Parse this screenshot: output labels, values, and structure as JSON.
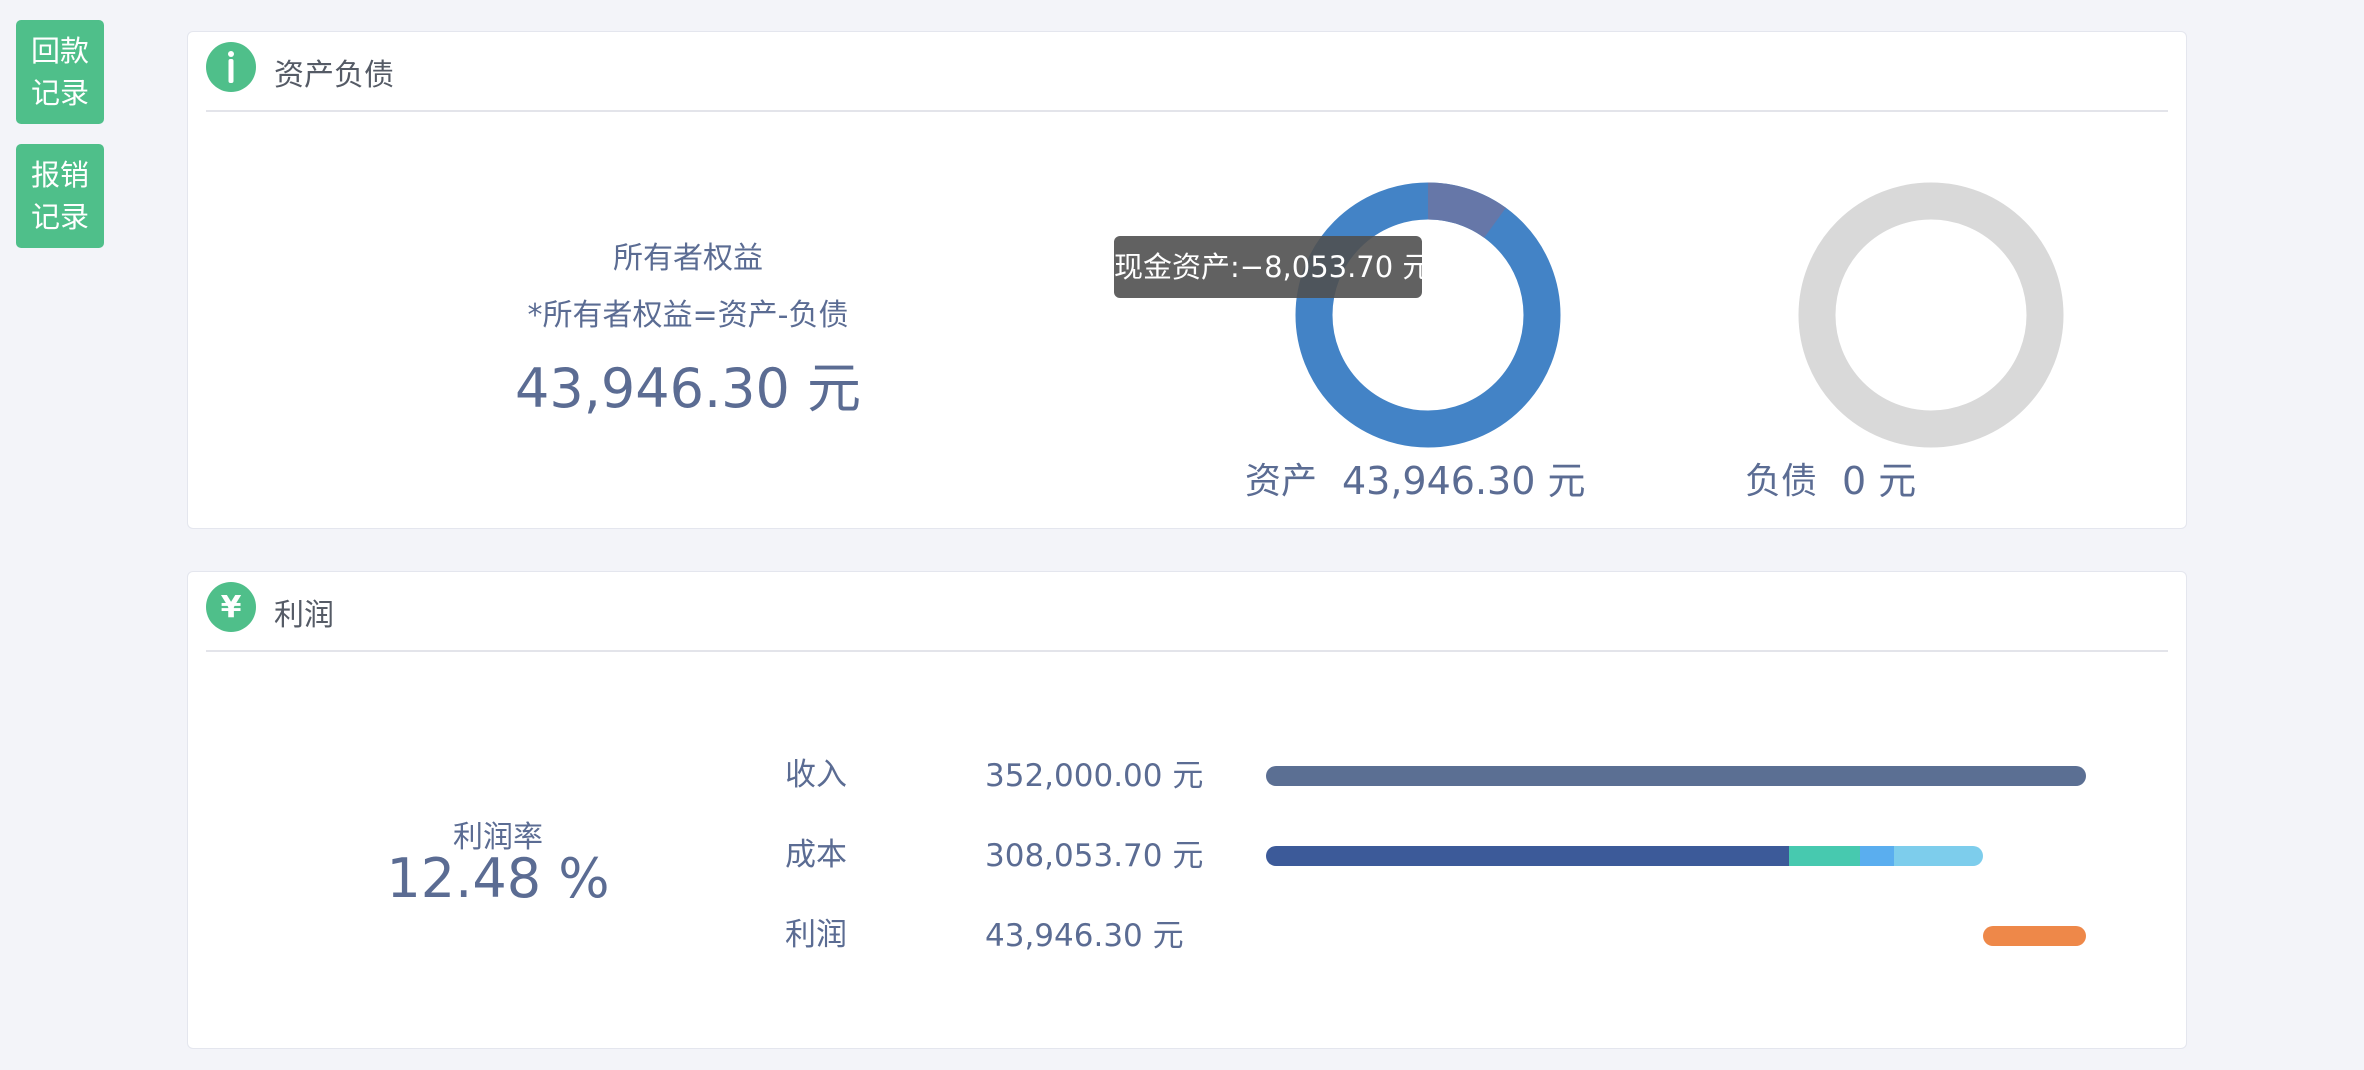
{
  "sidebar": {
    "repay_button": "回款\n记录",
    "reimburse_button": "报销\n记录"
  },
  "balance": {
    "title": "资产负债",
    "icon": "info-icon",
    "equity_label": "所有者权益",
    "equity_formula": "*所有者权益=资产-负债",
    "equity_value": "43,946.30 元",
    "assets_label": "资产",
    "assets_value": "43,946.30 元",
    "liabilities_label": "负债",
    "liabilities_value": "0 元",
    "tooltip": "现金资产:−8,053.70 元",
    "colors": {
      "assets_main": "#4383c6",
      "assets_cash": "#6677a8",
      "liabilities": "#d9d9d9"
    },
    "assets_donut": {
      "main_fraction": 0.9,
      "cash_fraction": 0.1
    }
  },
  "profit": {
    "title": "利润",
    "icon": "yen-icon",
    "rate_label": "利润率",
    "rate_value": "12.48 %",
    "rows": [
      {
        "label": "收入",
        "value": "352,000.00 元"
      },
      {
        "label": "成本",
        "value": "308,053.70 元"
      },
      {
        "label": "利润",
        "value": "43,946.30 元"
      }
    ],
    "colors": {
      "income": "#5b6f93",
      "cost_segments": [
        "#3c5a99",
        "#47c9af",
        "#5aaeef",
        "#7dcdec"
      ],
      "profit": "#ee8849"
    }
  }
}
